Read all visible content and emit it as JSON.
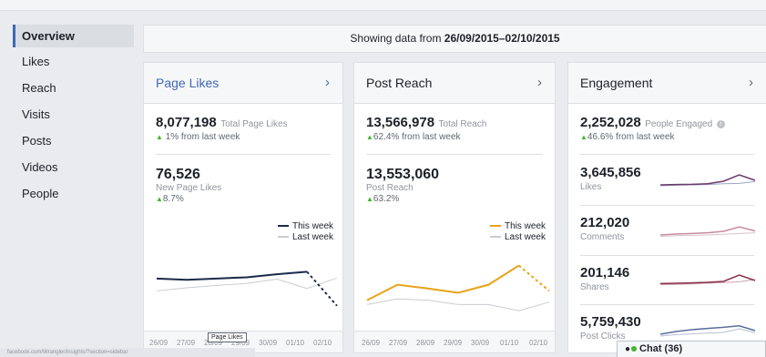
{
  "sidebar": {
    "items": [
      {
        "label": "Overview",
        "active": true
      },
      {
        "label": "Likes"
      },
      {
        "label": "Reach"
      },
      {
        "label": "Visits"
      },
      {
        "label": "Posts"
      },
      {
        "label": "Videos"
      },
      {
        "label": "People"
      }
    ]
  },
  "banner": {
    "prefix": "Showing data from ",
    "range": "26/09/2015–02/10/2015"
  },
  "cards": {
    "page_likes": {
      "title": "Page Likes",
      "total_value": "8,077,198",
      "total_label": "Total Page Likes",
      "total_change": "1% from last week",
      "sub_value": "76,526",
      "sub_label": "New Page Likes",
      "sub_change": "8.7%",
      "legend_this": "This week",
      "legend_last": "Last week"
    },
    "post_reach": {
      "title": "Post Reach",
      "total_value": "13,566,978",
      "total_label": "Total Reach",
      "total_change": "62.4% from last week",
      "sub_value": "13,553,060",
      "sub_label": "Post Reach",
      "sub_change": "63.2%",
      "legend_this": "This week",
      "legend_last": "Last week"
    },
    "engagement": {
      "title": "Engagement",
      "total_value": "2,252,028",
      "total_label": "People Engaged",
      "total_change": "46.6% from last week",
      "rows": [
        {
          "value": "3,645,856",
          "label": "Likes"
        },
        {
          "value": "212,020",
          "label": "Comments"
        },
        {
          "value": "201,146",
          "label": "Shares"
        },
        {
          "value": "5,759,430",
          "label": "Post Clicks"
        }
      ]
    }
  },
  "x_ticks": [
    "26/09",
    "27/09",
    "28/09",
    "29/09",
    "30/09",
    "01/10",
    "02/10"
  ],
  "tooltip": "Page Likes",
  "status_url": "facebook.com/Wrangler/insights/?section=sidebar",
  "chat": {
    "label": "Chat (36)"
  },
  "colors": {
    "accent": "#4267b2",
    "likes_this_week": "#1c2a4a",
    "reach_this_week": "#e8a317",
    "last_week": "#c9ccd1",
    "positive": "#42b72a"
  },
  "chart_data": [
    {
      "type": "line",
      "title": "Page Likes",
      "categories": [
        "26/09",
        "27/09",
        "28/09",
        "29/09",
        "30/09",
        "01/10",
        "02/10"
      ],
      "series": [
        {
          "name": "This week",
          "values": [
            0.62,
            0.6,
            0.62,
            0.64,
            0.69,
            0.73,
            0.18
          ]
        },
        {
          "name": "Last week",
          "values": [
            0.42,
            0.47,
            0.51,
            0.54,
            0.61,
            0.46,
            0.63
          ]
        }
      ],
      "ylim": [
        0,
        1
      ]
    },
    {
      "type": "line",
      "title": "Post Reach",
      "categories": [
        "26/09",
        "27/09",
        "28/09",
        "29/09",
        "30/09",
        "01/10",
        "02/10"
      ],
      "series": [
        {
          "name": "This week",
          "values": [
            0.27,
            0.52,
            0.46,
            0.39,
            0.52,
            0.83,
            0.42
          ]
        },
        {
          "name": "Last week",
          "values": [
            0.2,
            0.29,
            0.27,
            0.2,
            0.2,
            0.1,
            0.24
          ]
        }
      ],
      "ylim": [
        0,
        1
      ]
    },
    {
      "type": "line",
      "title": "Likes",
      "categories": [
        "26/09",
        "27/09",
        "28/09",
        "29/09",
        "30/09",
        "01/10",
        "02/10"
      ],
      "series": [
        {
          "name": "This week",
          "values": [
            0.3,
            0.32,
            0.33,
            0.36,
            0.5,
            0.85,
            0.55
          ]
        },
        {
          "name": "Last week",
          "values": [
            0.25,
            0.28,
            0.3,
            0.32,
            0.36,
            0.38,
            0.48
          ]
        }
      ],
      "ylim": [
        0,
        1
      ]
    },
    {
      "type": "line",
      "title": "Comments",
      "categories": [
        "26/09",
        "27/09",
        "28/09",
        "29/09",
        "30/09",
        "01/10",
        "02/10"
      ],
      "series": [
        {
          "name": "This week",
          "values": [
            0.3,
            0.35,
            0.38,
            0.42,
            0.5,
            0.74,
            0.52
          ]
        },
        {
          "name": "Last week",
          "values": [
            0.22,
            0.26,
            0.28,
            0.3,
            0.34,
            0.38,
            0.42
          ]
        }
      ],
      "ylim": [
        0,
        1
      ]
    },
    {
      "type": "line",
      "title": "Shares",
      "categories": [
        "26/09",
        "27/09",
        "28/09",
        "29/09",
        "30/09",
        "01/10",
        "02/10"
      ],
      "series": [
        {
          "name": "This week",
          "values": [
            0.38,
            0.4,
            0.42,
            0.45,
            0.5,
            0.85,
            0.55
          ]
        },
        {
          "name": "Last week",
          "values": [
            0.32,
            0.34,
            0.36,
            0.4,
            0.44,
            0.48,
            0.6
          ]
        }
      ],
      "ylim": [
        0,
        1
      ]
    },
    {
      "type": "line",
      "title": "Post Clicks",
      "categories": [
        "26/09",
        "27/09",
        "28/09",
        "29/09",
        "30/09",
        "01/10",
        "02/10"
      ],
      "series": [
        {
          "name": "This week",
          "values": [
            0.3,
            0.45,
            0.55,
            0.62,
            0.68,
            0.76,
            0.5
          ]
        },
        {
          "name": "Last week",
          "values": [
            0.2,
            0.28,
            0.32,
            0.36,
            0.4,
            0.6,
            0.38
          ]
        }
      ],
      "ylim": [
        0,
        1
      ]
    }
  ]
}
